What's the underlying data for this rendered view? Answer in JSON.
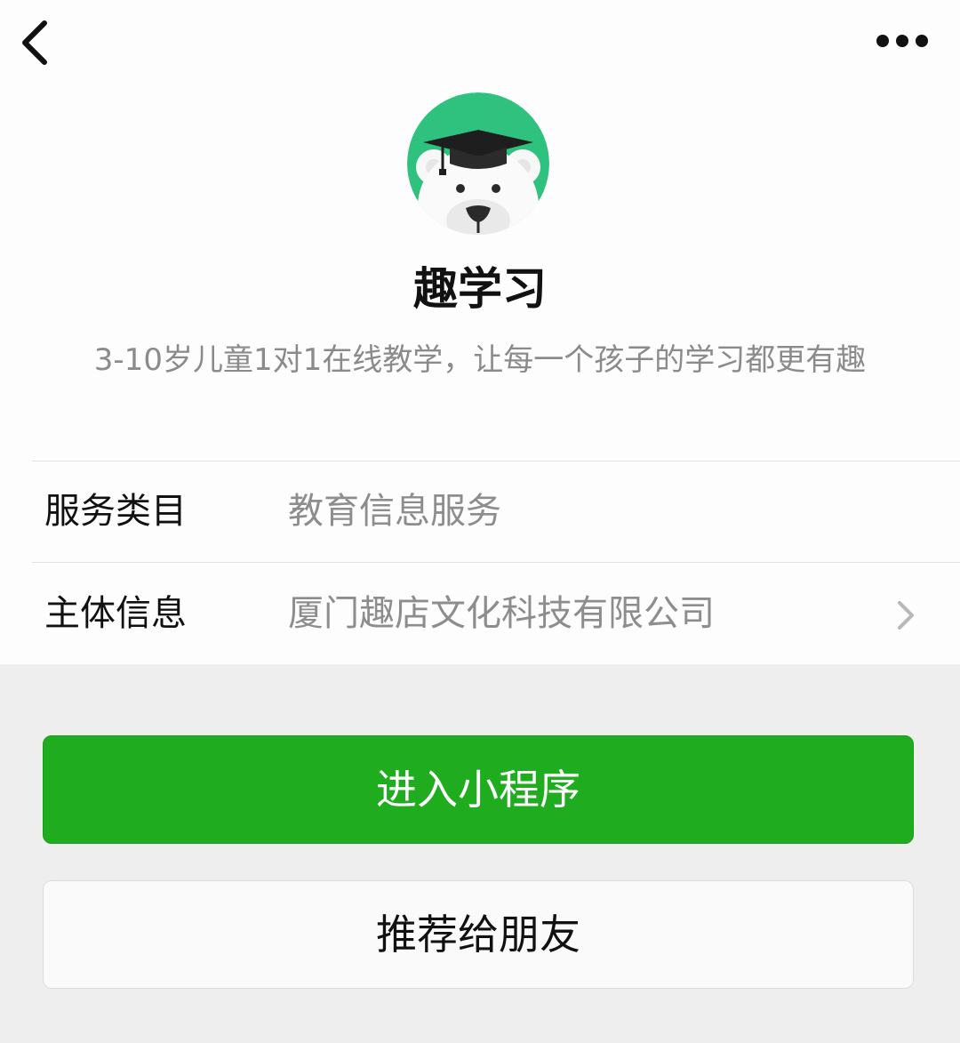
{
  "header": {
    "back_icon": "chevron-left-icon",
    "more_icon": "more-dots-icon"
  },
  "profile": {
    "avatar_icon": "polar-bear-graduation-cap-logo",
    "name": "趣学习",
    "description": "3-10岁儿童1对1在线教学，让每一个孩子的学习都更有趣"
  },
  "info": {
    "rows": [
      {
        "label": "服务类目",
        "value": "教育信息服务"
      },
      {
        "label": "主体信息",
        "value": "厦门趣店文化科技有限公司",
        "icon": "chevron-right-icon"
      }
    ]
  },
  "actions": {
    "enter_label": "进入小程序",
    "share_label": "推荐给朋友"
  },
  "colors": {
    "primary_green": "#1fad1f",
    "avatar_green": "#2ec27e",
    "page_background": "#eeeeee"
  }
}
